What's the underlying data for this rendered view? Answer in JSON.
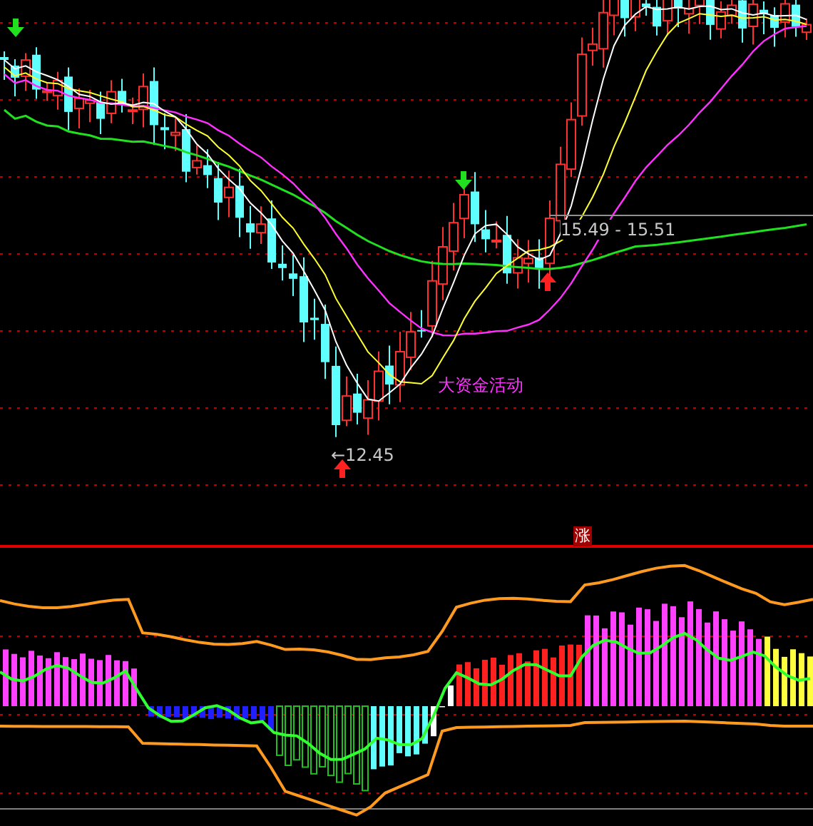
{
  "upper_panel": {
    "price_range_label": "15.49 - 15.51",
    "signal_label": "大资金活动",
    "low_price_label": "←12.45"
  },
  "lower_panel": {
    "badge": "涨"
  }
}
